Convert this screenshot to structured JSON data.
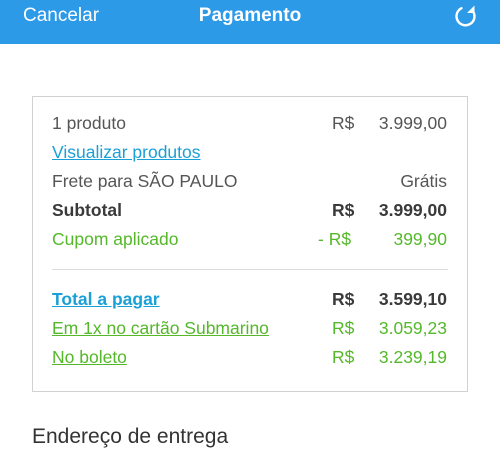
{
  "nav": {
    "cancel_label": "Cancelar",
    "title": "Pagamento",
    "refresh_icon": "refresh-icon"
  },
  "summary": {
    "product": {
      "label": "1 produto",
      "currency": "R$",
      "amount": "3.999,00"
    },
    "view_products_link": "Visualizar produtos",
    "shipping": {
      "label": "Frete para SÃO PAULO",
      "amount": "Grátis"
    },
    "subtotal": {
      "label": "Subtotal",
      "currency": "R$",
      "amount": "3.999,00"
    },
    "coupon": {
      "label": "Cupom aplicado",
      "currency": "- R$",
      "amount": "399,90"
    },
    "total": {
      "label": "Total a pagar",
      "currency": "R$",
      "amount": "3.599,10"
    },
    "installment": {
      "label": "Em 1x no cartão Submarino",
      "currency": "R$",
      "amount": "3.059,23"
    },
    "boleto": {
      "label": "No boleto",
      "currency": "R$",
      "amount": "3.239,19"
    }
  },
  "delivery": {
    "title": "Endereço de entrega"
  },
  "colors": {
    "header_blue": "#2d9ae8",
    "link_blue": "#1a9fd6",
    "discount_green": "#55b82a",
    "text_gray": "#555555"
  }
}
